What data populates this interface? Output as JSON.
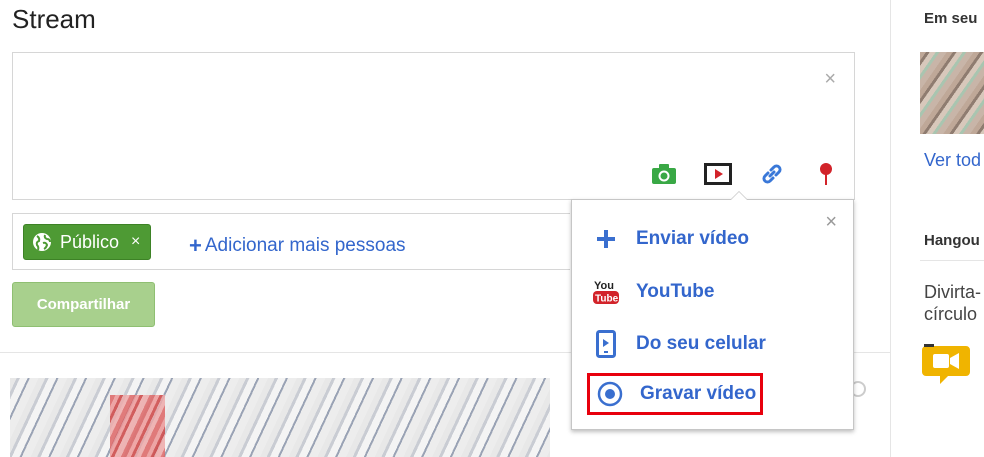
{
  "stream": {
    "title": "Stream"
  },
  "composer": {
    "close_glyph": "×",
    "attach": [
      {
        "icon": "camera-icon",
        "color": "#39a845"
      },
      {
        "icon": "video-icon",
        "color": "#222222"
      },
      {
        "icon": "link-icon",
        "color": "#3a78d8"
      },
      {
        "icon": "map-pin-icon",
        "color": "#d2232a"
      }
    ]
  },
  "share": {
    "chip_label": "Público",
    "chip_remove": "×",
    "add_people_plus": "+",
    "add_people": "Adicionar mais pessoas",
    "button_label": "Compartilhar"
  },
  "video_menu": {
    "close_glyph": "×",
    "items": [
      {
        "label": "Enviar vídeo",
        "icon": "plus-icon"
      },
      {
        "label": "YouTube",
        "icon": "youtube-icon"
      },
      {
        "label": "Do seu celular",
        "icon": "phone-icon"
      },
      {
        "label": "Gravar vídeo",
        "icon": "record-icon"
      }
    ],
    "highlight_color": "#e8000d"
  },
  "sidebar": {
    "heading": "Em seu",
    "link": "Ver tod",
    "hangout_heading": "Hangou",
    "hangout_text_line1": "Divirta-",
    "hangout_text_line2": "círculo"
  },
  "colors": {
    "link_blue": "#3366cc",
    "share_green": "#4e9a34",
    "share_button_disabled": "#a8d08d"
  }
}
